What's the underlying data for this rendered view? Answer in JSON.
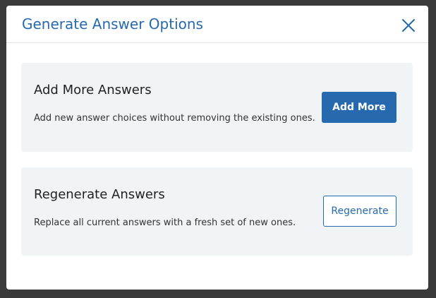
{
  "dialog": {
    "title": "Generate Answer Options",
    "close_icon": "close-icon",
    "accent_color": "#2769ae"
  },
  "options": {
    "add_more": {
      "title": "Add More Answers",
      "description": "Add new answer choices without removing the existing ones.",
      "button_label": "Add More"
    },
    "regenerate": {
      "title": "Regenerate Answers",
      "description": "Replace all current answers with a fresh set of new ones.",
      "button_label": "Regenerate"
    }
  }
}
